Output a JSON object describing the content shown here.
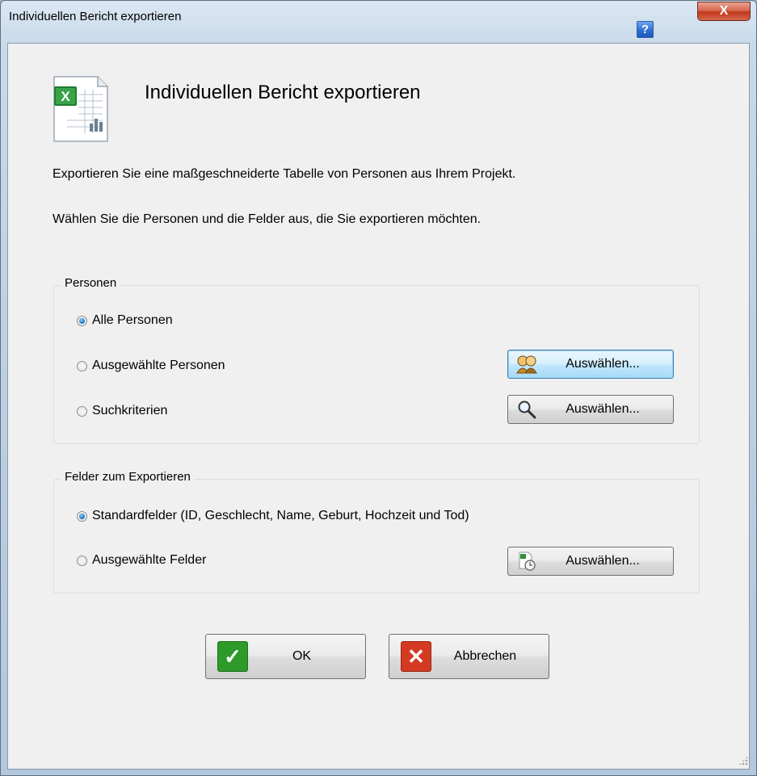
{
  "window": {
    "title": "Individuellen Bericht exportieren",
    "help_label": "?",
    "close_label": "X"
  },
  "header": {
    "icon": "excel-document-icon",
    "heading": "Individuellen Bericht exportieren"
  },
  "description": {
    "line1": "Exportieren Sie eine maßgeschneiderte Tabelle von Personen aus Ihrem Projekt.",
    "line2": "Wählen Sie die Personen und die Felder aus, die Sie exportieren möchten."
  },
  "persons_group": {
    "label": "Personen",
    "options": [
      {
        "label": "Alle Personen",
        "checked": true
      },
      {
        "label": "Ausgewählte Personen",
        "checked": false,
        "button_label": "Auswählen...",
        "button_icon": "people-icon"
      },
      {
        "label": "Suchkriterien",
        "checked": false,
        "button_label": "Auswählen...",
        "button_icon": "magnifier-icon"
      }
    ]
  },
  "fields_group": {
    "label": "Felder zum Exportieren",
    "options": [
      {
        "label": "Standardfelder (ID, Geschlecht, Name, Geburt, Hochzeit und Tod)",
        "checked": true
      },
      {
        "label": "Ausgewählte Felder",
        "checked": false,
        "button_label": "Auswählen...",
        "button_icon": "field-select-icon"
      }
    ]
  },
  "footer": {
    "ok_label": "OK",
    "cancel_label": "Abbrechen"
  },
  "colors": {
    "ok_icon": "#2e9a2a",
    "cancel_icon": "#d43a21",
    "radio_selected": "#1e78c8"
  }
}
